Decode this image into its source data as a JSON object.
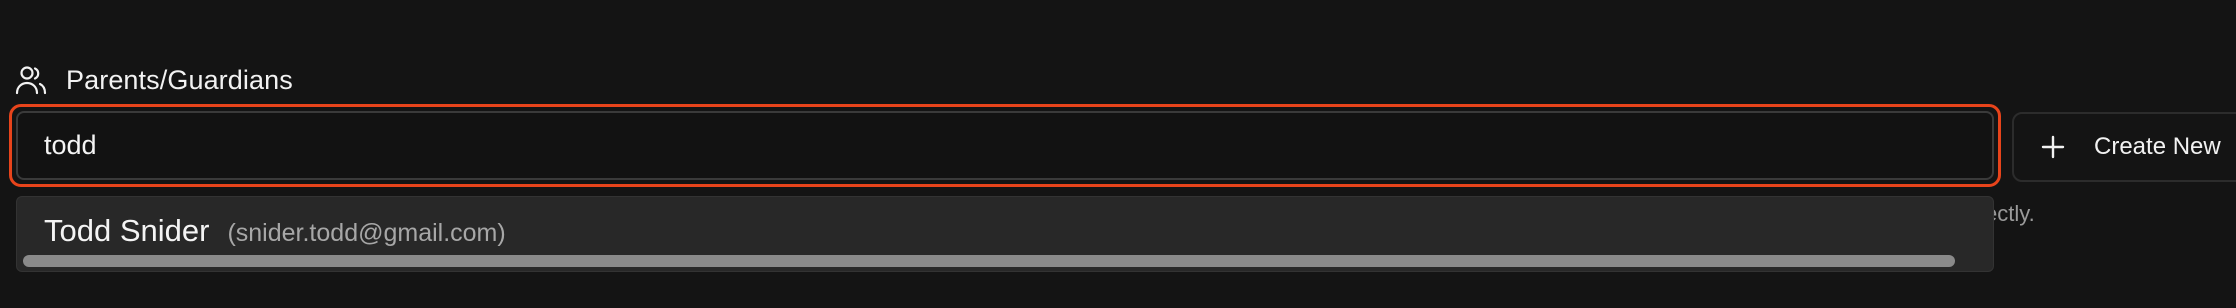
{
  "section": {
    "icon": "users-icon",
    "title": "Parents/Guardians"
  },
  "search": {
    "value": "todd",
    "focus_ring_color": "#e8441b"
  },
  "create_button": {
    "icon": "plus-icon",
    "label": "Create New"
  },
  "helper_text_fragment": "ectly.",
  "dropdown": {
    "options": [
      {
        "name": "Todd Snider",
        "email": "(snider.todd@gmail.com)"
      }
    ]
  }
}
